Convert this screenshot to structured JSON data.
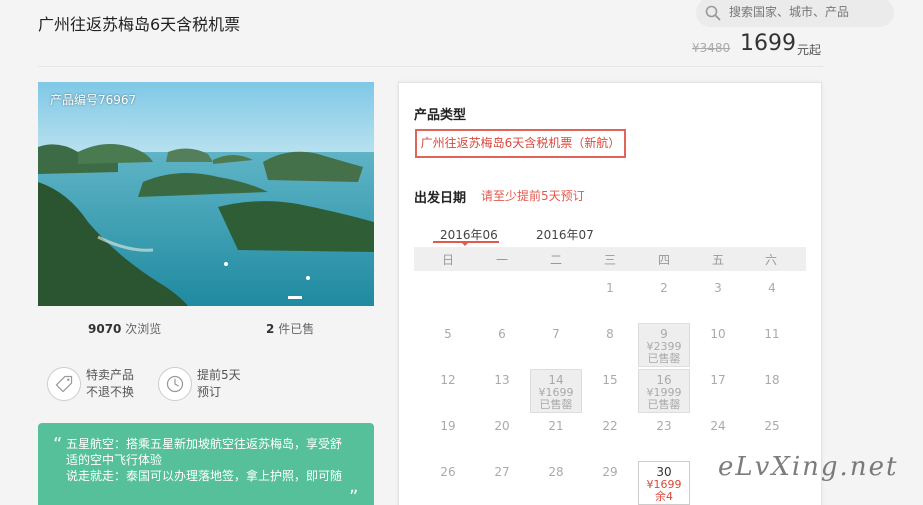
{
  "header": {
    "title": "广州往返苏梅岛6天含税机票",
    "search_placeholder": "搜索国家、城市、产品",
    "old_price": "¥3480",
    "price": "1699",
    "price_unit": "元起"
  },
  "product": {
    "id_label": "产品编号76967",
    "views_count": "9070",
    "views_label": "次浏览",
    "sold_count": "2",
    "sold_label": "件已售",
    "tags": [
      {
        "line1": "特卖产品",
        "line2": "不退不换"
      },
      {
        "line1": "提前5天",
        "line2": "预订"
      }
    ],
    "promo_line1": "五星航空：搭乘五星新加坡航空往返苏梅岛，享受舒适的空中飞行体验",
    "promo_line2": "说走就走：泰国可以办理落地签，拿上护照，即可随",
    "quote_open": "“",
    "quote_close": "„"
  },
  "booking": {
    "type_label": "产品类型",
    "type_option": "广州往返苏梅岛6天含税机票（新航）",
    "date_label": "出发日期",
    "date_hint": "请至少提前5天预订",
    "months": [
      "2016年06",
      "2016年07"
    ],
    "weekdays": [
      "日",
      "一",
      "二",
      "三",
      "四",
      "五",
      "六"
    ],
    "days": [
      {
        "num": "1"
      },
      {
        "num": "2"
      },
      {
        "num": "3"
      },
      {
        "num": "4"
      },
      {
        "num": "5"
      },
      {
        "num": "6"
      },
      {
        "num": "7"
      },
      {
        "num": "8"
      },
      {
        "num": "9",
        "price": "¥2399",
        "status": "已售罄"
      },
      {
        "num": "10"
      },
      {
        "num": "11"
      },
      {
        "num": "12"
      },
      {
        "num": "13"
      },
      {
        "num": "14",
        "price": "¥1699",
        "status": "已售罄"
      },
      {
        "num": "15"
      },
      {
        "num": "16",
        "price": "¥1999",
        "status": "已售罄"
      },
      {
        "num": "17"
      },
      {
        "num": "18"
      },
      {
        "num": "19"
      },
      {
        "num": "20"
      },
      {
        "num": "21"
      },
      {
        "num": "22"
      },
      {
        "num": "23"
      },
      {
        "num": "24"
      },
      {
        "num": "25"
      },
      {
        "num": "26"
      },
      {
        "num": "27"
      },
      {
        "num": "28"
      },
      {
        "num": "29"
      },
      {
        "num": "30",
        "price": "¥1699",
        "status": "余4"
      }
    ]
  },
  "watermark": "eLvXing.net"
}
